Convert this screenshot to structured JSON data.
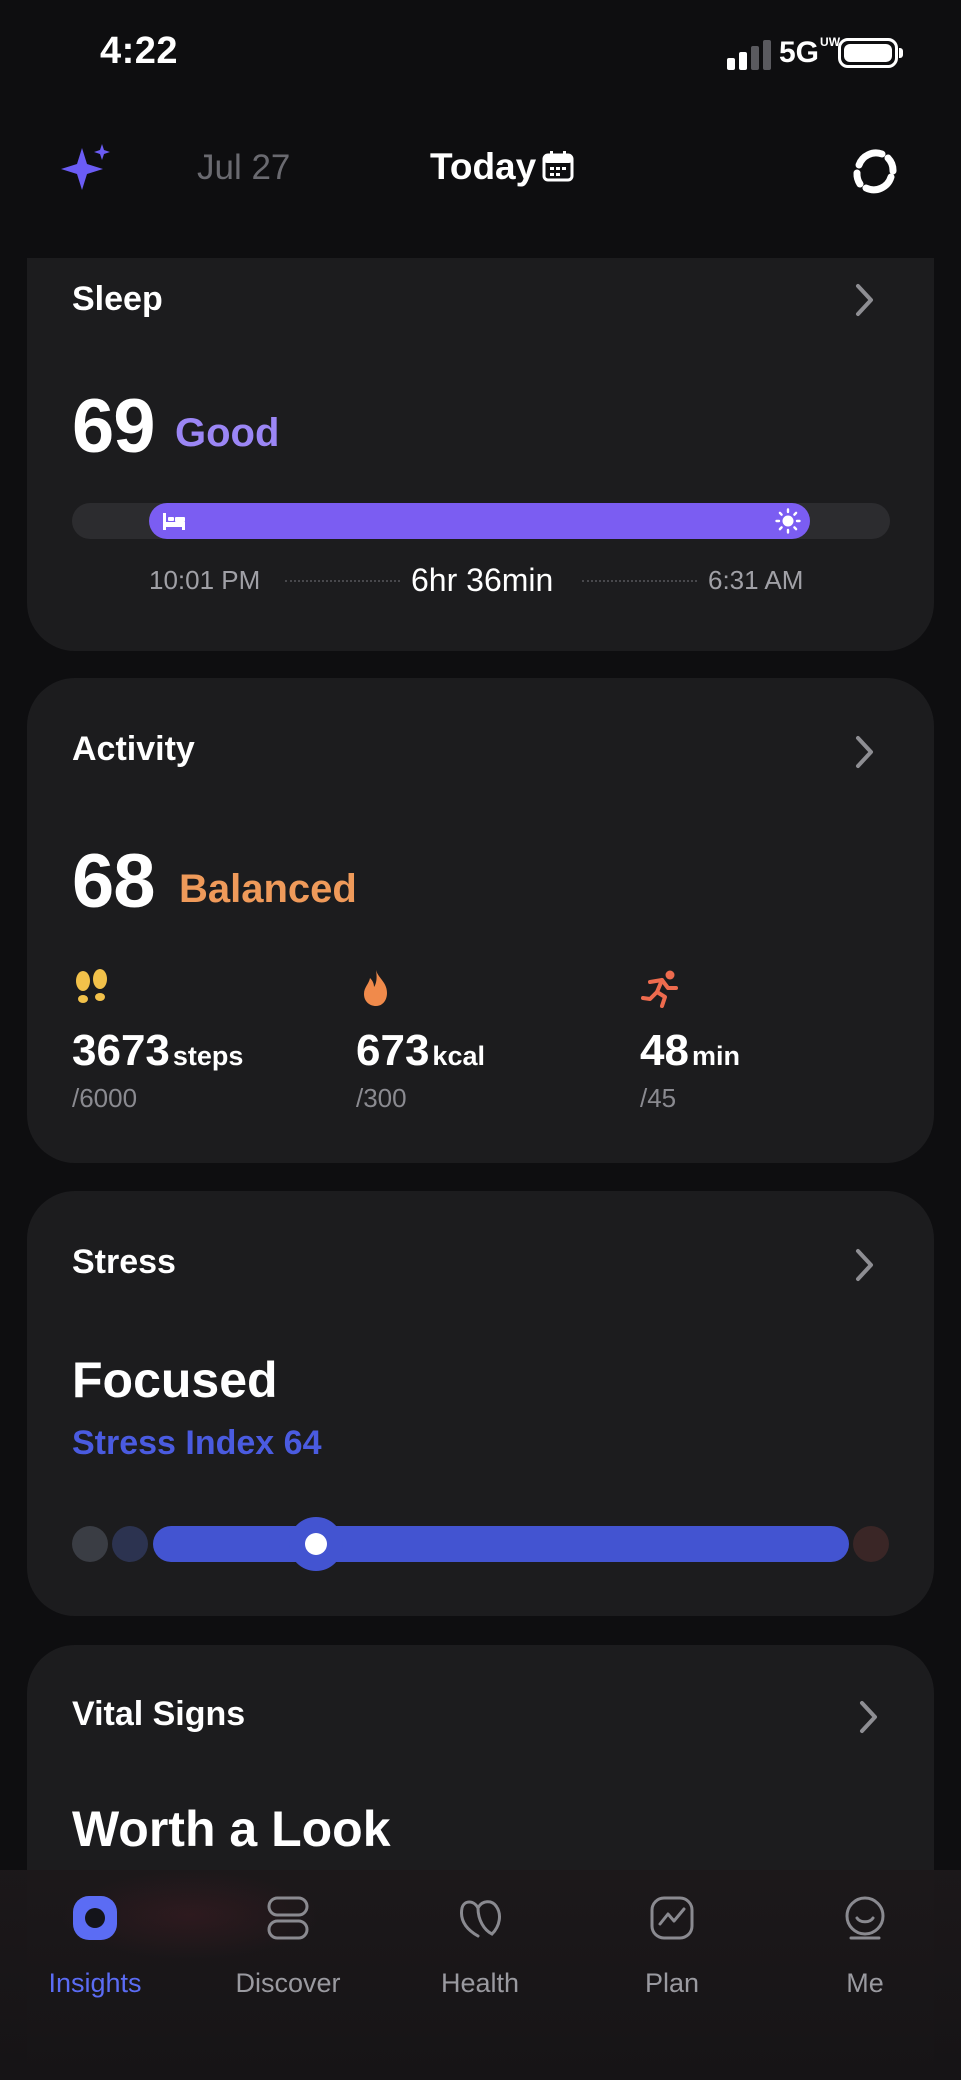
{
  "status_bar": {
    "time": "4:22",
    "network": "5G",
    "network_suffix": "UW"
  },
  "header": {
    "prev_date": "Jul 27",
    "current": "Today",
    "icons": [
      "sparkle-icon",
      "calendar-icon",
      "sync-icon"
    ]
  },
  "sleep": {
    "title": "Sleep",
    "score": "69",
    "rating": "Good",
    "start": "10:01 PM",
    "duration": "6hr 36min",
    "end": "6:31 AM",
    "colors": {
      "accent": "#9b86f5",
      "bar": "#7b5df2"
    }
  },
  "activity": {
    "title": "Activity",
    "score": "68",
    "rating": "Balanced",
    "accent": "#ef9a5a",
    "metrics": [
      {
        "icon": "footsteps-icon",
        "value": "3673",
        "unit": "steps",
        "goal": "/6000",
        "color": "#f2c14a"
      },
      {
        "icon": "flame-icon",
        "value": "673",
        "unit": "kcal",
        "goal": "/300",
        "color": "#f08a4b"
      },
      {
        "icon": "runner-icon",
        "value": "48",
        "unit": "min",
        "goal": "/45",
        "color": "#ee6b4e"
      }
    ]
  },
  "stress": {
    "title": "Stress",
    "state": "Focused",
    "index_text": "Stress Index 64",
    "accent": "#4a5be0"
  },
  "vital": {
    "title": "Vital Signs",
    "headline": "Worth a Look"
  },
  "tabs": [
    {
      "label": "Insights",
      "icon": "insights-icon",
      "active": true
    },
    {
      "label": "Discover",
      "icon": "discover-icon",
      "active": false
    },
    {
      "label": "Health",
      "icon": "health-icon",
      "active": false
    },
    {
      "label": "Plan",
      "icon": "plan-icon",
      "active": false
    },
    {
      "label": "Me",
      "icon": "me-icon",
      "active": false
    }
  ]
}
